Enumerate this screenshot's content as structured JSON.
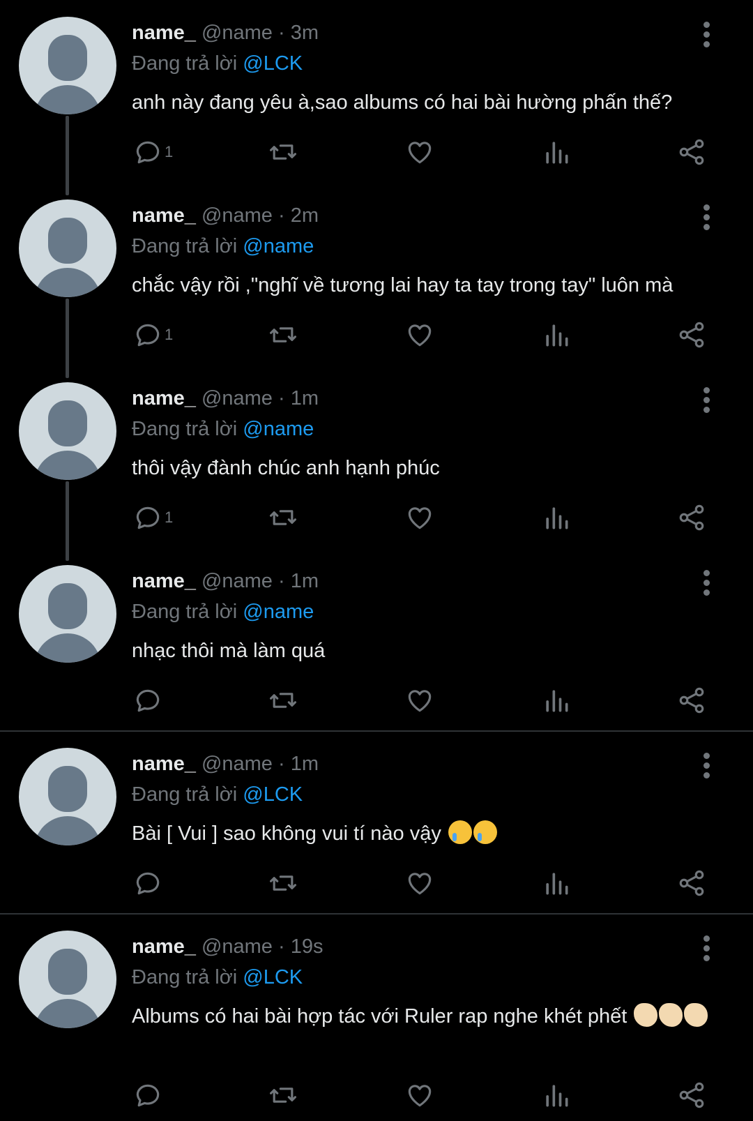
{
  "tweets": [
    {
      "name": "name_",
      "handle": "@name",
      "sep": "·",
      "time": "3m",
      "reply_prefix": "Đang trả lời",
      "reply_to": "@LCK",
      "text": "anh này đang yêu à,sao albums có hai bài hường phấn thế?",
      "reply_count": "1"
    },
    {
      "name": "name_",
      "handle": "@name",
      "sep": "·",
      "time": "2m",
      "reply_prefix": "Đang trả lời",
      "reply_to": "@name",
      "text": "chắc vậy rồi ,\"nghĩ về tương lai hay ta tay trong tay\" luôn mà",
      "reply_count": "1"
    },
    {
      "name": "name_",
      "handle": "@name",
      "sep": "·",
      "time": "1m",
      "reply_prefix": "Đang trả lời",
      "reply_to": "@name",
      "text": "thôi vậy đành chúc anh hạnh phúc",
      "reply_count": "1"
    },
    {
      "name": "name_",
      "handle": "@name",
      "sep": "·",
      "time": "1m",
      "reply_prefix": "Đang trả lời",
      "reply_to": "@name",
      "text": "nhạc thôi mà làm quá",
      "reply_count": ""
    },
    {
      "name": "name_",
      "handle": "@name",
      "sep": "·",
      "time": "1m",
      "reply_prefix": "Đang trả lời",
      "reply_to": "@LCK",
      "text": "Bài [ Vui ] sao không vui tí nào vậy",
      "reply_count": ""
    },
    {
      "name": "name_",
      "handle": "@name",
      "sep": "·",
      "time": "19s",
      "reply_prefix": "Đang trả lời",
      "reply_to": "@LCK",
      "text": "Albums có hai bài hợp tác với Ruler rap nghe khét phết",
      "reply_count": ""
    }
  ],
  "emojis": {
    "tweet5": [
      "crying-face",
      "crying-face"
    ],
    "tweet6": [
      "clapping-hands",
      "clapping-hands",
      "clapping-hands"
    ]
  },
  "icons": [
    "reply-icon",
    "retweet-icon",
    "like-icon",
    "views-icon",
    "share-icon",
    "more-icon"
  ],
  "colors": {
    "background": "#000000",
    "text": "#e7e9ea",
    "muted": "#71767b",
    "link": "#1d9bf0",
    "divider": "#2f3336"
  }
}
